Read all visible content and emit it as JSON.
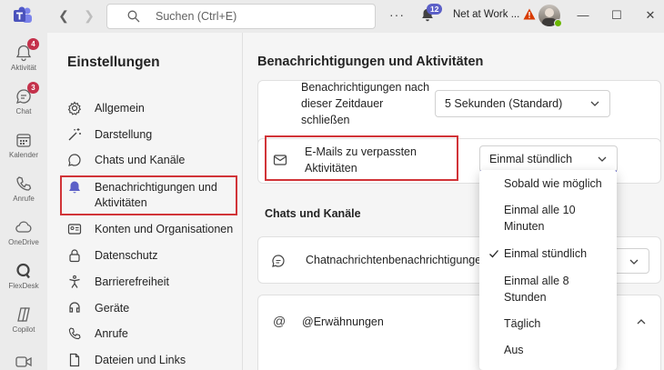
{
  "window": {
    "search_placeholder": "Suchen (Ctrl+E)",
    "more_label": "···",
    "activity_count": "12",
    "org_name": "Net at Work ...",
    "minimize": "—",
    "maximize": "☐",
    "close": "✕"
  },
  "rail": [
    {
      "label": "Aktivität",
      "badge": "4",
      "icon": "bell-icon"
    },
    {
      "label": "Chat",
      "badge": "3",
      "icon": "chat-icon"
    },
    {
      "label": "Kalender",
      "badge": "",
      "icon": "calendar-icon"
    },
    {
      "label": "Anrufe",
      "badge": "",
      "icon": "phone-icon"
    },
    {
      "label": "OneDrive",
      "badge": "",
      "icon": "cloud-icon"
    },
    {
      "label": "FlexDesk",
      "badge": "",
      "icon": "flexdesk-icon"
    },
    {
      "label": "Copilot",
      "badge": "",
      "icon": "copilot-icon"
    }
  ],
  "settings": {
    "title": "Einstellungen",
    "items": [
      {
        "label": "Allgemein",
        "icon": "gear-icon"
      },
      {
        "label": "Darstellung",
        "icon": "wand-icon"
      },
      {
        "label": "Chats und Kanäle",
        "icon": "chat-icon"
      },
      {
        "label": "Benachrichtigungen und",
        "label2": "Aktivitäten",
        "icon": "bell-icon",
        "selected": true
      },
      {
        "label": "Konten und Organisationen",
        "icon": "id-card-icon"
      },
      {
        "label": "Datenschutz",
        "icon": "lock-icon"
      },
      {
        "label": "Barrierefreiheit",
        "icon": "accessibility-icon"
      },
      {
        "label": "Geräte",
        "icon": "device-icon"
      },
      {
        "label": "Anrufe",
        "icon": "phone-icon"
      },
      {
        "label": "Dateien und Links",
        "icon": "file-icon"
      }
    ]
  },
  "main": {
    "title": "Benachrichtigungen und Aktivitäten",
    "duration_label_1": "Benachrichtigungen nach",
    "duration_label_2": "dieser Zeitdauer",
    "duration_label_3": "schließen",
    "duration_value": "5 Sekunden (Standard)",
    "email_label_1": "E-Mails zu verpassten",
    "email_label_2": "Aktivitäten",
    "email_value": "Einmal stündlich",
    "section_chats": "Chats und Kanäle",
    "chat_notif_label": "Chatnachrichtenbenachrichtigungen",
    "mentions_label": "@Erwähnungen"
  },
  "email_menu": {
    "options": [
      "Sobald wie möglich",
      "Einmal alle 10",
      "Minuten",
      "Einmal stündlich",
      "Einmal alle 8",
      "Stunden",
      "Täglich",
      "Aus"
    ],
    "selected": "Einmal stündlich"
  },
  "colors": {
    "accent": "#5b5fc7",
    "highlight": "#d13438",
    "badge": "#c4314b"
  }
}
